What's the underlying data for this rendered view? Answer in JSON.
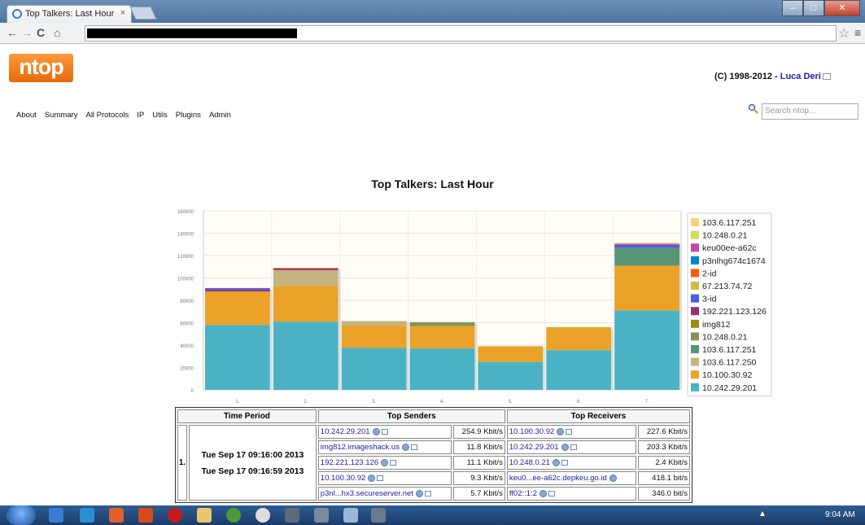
{
  "browser": {
    "tab_title": "Top Talkers: Last Hour",
    "tab_close": "×"
  },
  "toolbar": {
    "back": "←",
    "forward": "→",
    "reload": "C",
    "home": "⌂",
    "star": "☆",
    "menu": "≡"
  },
  "header": {
    "logo": "ntop",
    "copyright": "(C) 1998-2012 - ",
    "author": "Luca Deri"
  },
  "nav": {
    "items": [
      "About",
      "Summary",
      "All Protocols",
      "IP",
      "Utils",
      "Plugins",
      "Admin"
    ]
  },
  "search": {
    "placeholder": "Search ntop..."
  },
  "page": {
    "title": "Top Talkers: Last Hour"
  },
  "chart_data": {
    "type": "bar",
    "stacked": true,
    "title": "",
    "xlabel": "",
    "ylabel": "",
    "ylim": [
      0,
      160000
    ],
    "yticks": [
      0,
      20000,
      40000,
      60000,
      80000,
      100000,
      120000,
      140000,
      160000
    ],
    "grid": true,
    "legend_position": "right",
    "categories": [
      "1.",
      "2.",
      "3.",
      "4.",
      "5.",
      "6.",
      "7."
    ],
    "series": [
      {
        "name": "10.242.29.201",
        "color": "#4bb2c5",
        "values": [
          58000,
          61000,
          37500,
          37000,
          25000,
          35500,
          71000
        ]
      },
      {
        "name": "10.100.30.92",
        "color": "#eaa228",
        "values": [
          30000,
          32000,
          20000,
          20000,
          14000,
          20500,
          40000
        ]
      },
      {
        "name": "103.6.117.250",
        "color": "#c5b47f",
        "values": [
          0,
          14000,
          4000,
          0,
          0,
          0,
          0
        ]
      },
      {
        "name": "103.6.117.251",
        "color": "#579575",
        "values": [
          0,
          0,
          0,
          0,
          0,
          0,
          16000
        ]
      },
      {
        "name": "10.248.0.21",
        "color": "#839557",
        "values": [
          0,
          0,
          0,
          3500,
          0,
          0,
          0
        ]
      },
      {
        "name": "img812",
        "color": "#958c12",
        "values": [
          0,
          0,
          0,
          0,
          0,
          0,
          0
        ]
      },
      {
        "name": "192.221.123.126",
        "color": "#953579",
        "values": [
          1500,
          1500,
          0,
          0,
          0,
          0,
          0
        ]
      },
      {
        "name": "3-id",
        "color": "#4b5de4",
        "values": [
          1500,
          0,
          0,
          0,
          0,
          0,
          2500
        ]
      },
      {
        "name": "67.213.74.72",
        "color": "#d8b83f",
        "values": [
          0,
          0,
          0,
          0,
          0,
          0,
          0
        ]
      },
      {
        "name": "2-id",
        "color": "#ff5800",
        "values": [
          0,
          500,
          0,
          0,
          0,
          0,
          0
        ]
      },
      {
        "name": "p3nlhg674c1674",
        "color": "#0085cc",
        "values": [
          0,
          0,
          0,
          0,
          0,
          0,
          0
        ]
      },
      {
        "name": "keu00ee-a62c",
        "color": "#c747a3",
        "values": [
          0,
          0,
          0,
          0,
          0,
          0,
          1000
        ]
      },
      {
        "name": "10.248.0.21",
        "color": "#cddf54",
        "values": [
          0,
          0,
          0,
          0,
          0,
          0,
          0
        ]
      },
      {
        "name": "103.6.117.251",
        "color": "#fbd178",
        "values": [
          0,
          0,
          0,
          0,
          0,
          0,
          1000
        ]
      }
    ]
  },
  "table": {
    "headers": {
      "period": "Time Period",
      "senders": "Top Senders",
      "receivers": "Top Receivers"
    },
    "rank": "1.",
    "period_start": "Tue Sep 17 09:16:00 2013",
    "period_end": "Tue Sep 17 09:16:59 2013",
    "rows": [
      {
        "sender": "10.242.29.201",
        "sender_rate": "254.9 Kbit/s",
        "receiver": "10.100.30.92",
        "receiver_rate": "227.6 Kbit/s"
      },
      {
        "sender": "img812.imageshack.us",
        "sender_rate": "11.8 Kbit/s",
        "receiver": "10.242.29.201",
        "receiver_rate": "203.3 Kbit/s"
      },
      {
        "sender": "192.221.123.126",
        "sender_rate": "11.1 Kbit/s",
        "receiver": "10.248.0.21",
        "receiver_rate": "2.4 Kbit/s"
      },
      {
        "sender": "10.100.30.92",
        "sender_rate": "9.3 Kbit/s",
        "receiver": "keu0...ee-a62c.depkeu.go.id",
        "receiver_rate": "418.1 bit/s"
      },
      {
        "sender": "p3nl...hx3.secureserver.net",
        "sender_rate": "5.7 Kbit/s",
        "receiver": "ff02::1:2",
        "receiver_rate": "346.0 bit/s"
      }
    ]
  },
  "taskbar": {
    "clock": "9:04 AM",
    "tray": "▲"
  }
}
